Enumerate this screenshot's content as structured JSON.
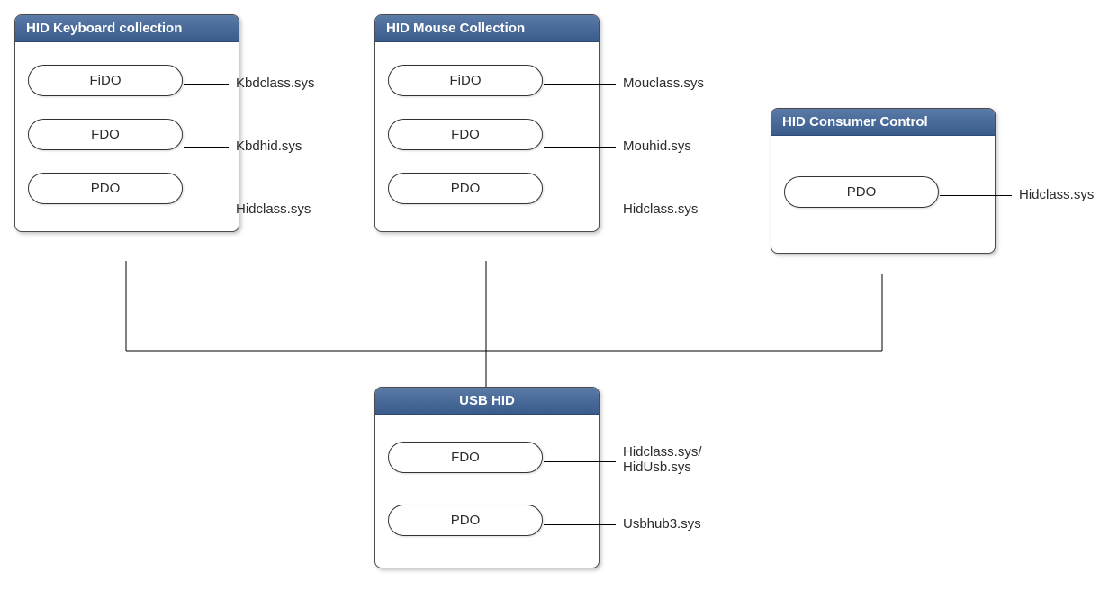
{
  "diagram": {
    "keyboard": {
      "title": "HID Keyboard collection",
      "rows": [
        {
          "pill": "FiDO",
          "annot": "Kbdclass.sys"
        },
        {
          "pill": "FDO",
          "annot": "Kbdhid.sys"
        },
        {
          "pill": "PDO",
          "annot": "Hidclass.sys"
        }
      ]
    },
    "mouse": {
      "title": "HID Mouse Collection",
      "rows": [
        {
          "pill": "FiDO",
          "annot": "Mouclass.sys"
        },
        {
          "pill": "FDO",
          "annot": "Mouhid.sys"
        },
        {
          "pill": "PDO",
          "annot": "Hidclass.sys"
        }
      ]
    },
    "consumer": {
      "title": "HID Consumer Control",
      "rows": [
        {
          "pill": "PDO",
          "annot": "Hidclass.sys"
        }
      ]
    },
    "usbhid": {
      "title": "USB HID",
      "rows": [
        {
          "pill": "FDO",
          "annot": "Hidclass.sys/\nHidUsb.sys"
        },
        {
          "pill": "PDO",
          "annot": "Usbhub3.sys"
        }
      ]
    }
  }
}
